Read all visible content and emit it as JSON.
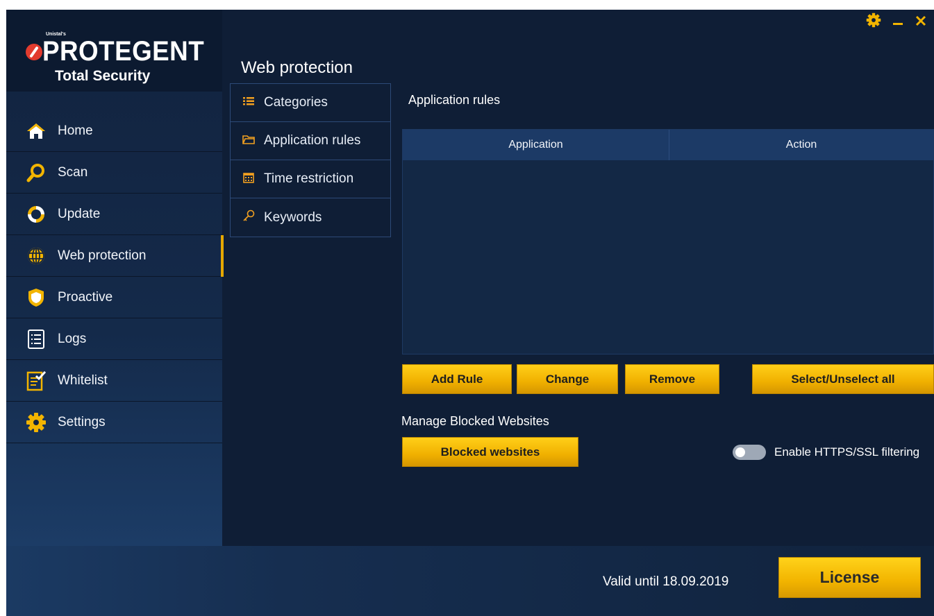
{
  "app": {
    "brand_small": "Unistal's",
    "brand": "PROTEGENT",
    "product": "Total Security"
  },
  "sidebar": {
    "items": [
      {
        "label": "Home",
        "icon": "home-icon"
      },
      {
        "label": "Scan",
        "icon": "search-icon"
      },
      {
        "label": "Update",
        "icon": "refresh-icon"
      },
      {
        "label": "Web protection",
        "icon": "globe-icon",
        "active": true
      },
      {
        "label": "Proactive",
        "icon": "shield-icon"
      },
      {
        "label": "Logs",
        "icon": "list-icon"
      },
      {
        "label": "Whitelist",
        "icon": "checklist-icon"
      },
      {
        "label": "Settings",
        "icon": "gear-icon"
      }
    ]
  },
  "section": {
    "title": "Web protection",
    "submenu": [
      {
        "label": "Categories",
        "icon": "list-icon"
      },
      {
        "label": "Application rules",
        "icon": "folder-icon",
        "active": true
      },
      {
        "label": "Time restriction",
        "icon": "calendar-icon"
      },
      {
        "label": "Keywords",
        "icon": "key-icon"
      }
    ]
  },
  "panel": {
    "title": "Application rules",
    "columns": [
      "Application",
      "Action"
    ],
    "rows": [],
    "buttons": {
      "add": "Add Rule",
      "change": "Change",
      "remove": "Remove",
      "select_all": "Select/Unselect all"
    },
    "manage_label": "Manage Blocked Websites",
    "blocked_button": "Blocked websites",
    "https_toggle": {
      "label": "Enable HTTPS/SSL filtering",
      "enabled": false
    }
  },
  "footer": {
    "valid_until": "Valid until 18.09.2019",
    "license": "License"
  },
  "colors": {
    "accent": "#f2b400",
    "background": "#0f1e36",
    "sidebar": "#12233f"
  }
}
